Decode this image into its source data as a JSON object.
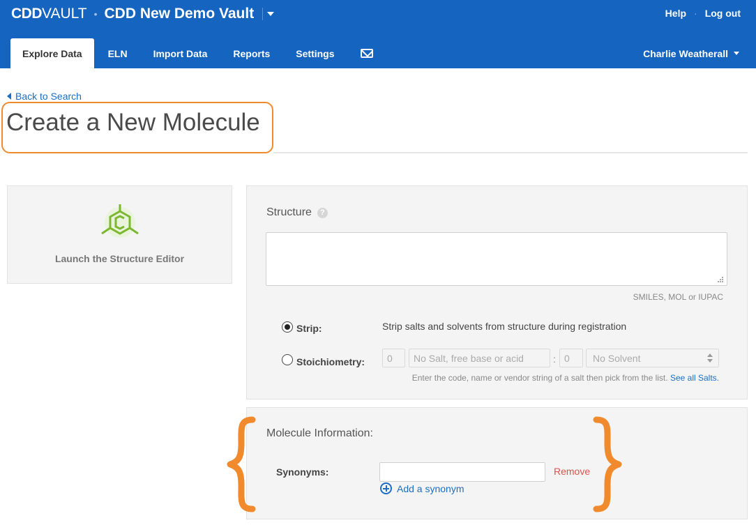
{
  "header": {
    "brand": {
      "left": "CDD",
      "right": "VAULT",
      "separator": "•"
    },
    "vault_name": "CDD New Demo Vault",
    "links": {
      "help": "Help",
      "separator": "·",
      "logout": "Log out"
    },
    "nav": [
      {
        "label": "Explore Data",
        "active": true
      },
      {
        "label": "ELN"
      },
      {
        "label": "Import Data"
      },
      {
        "label": "Reports"
      },
      {
        "label": "Settings"
      }
    ],
    "user_name": "Charlie Weatherall",
    "mail_icon": "envelope-icon"
  },
  "page": {
    "back_link": "Back to Search",
    "title": "Create a New Molecule"
  },
  "launch_panel": {
    "icon": "structure-editor-icon",
    "label": "Launch the Structure Editor"
  },
  "structure": {
    "label": "Structure",
    "help": "?",
    "input_value": "",
    "hint": "SMILES, MOL or IUPAC",
    "strip": {
      "label": "Strip:",
      "selected": true,
      "description": "Strip salts and solvents from structure during registration"
    },
    "stoichiometry": {
      "label": "Stoichiometry:",
      "selected": false,
      "salt_count": "0",
      "salt_value": "No Salt, free base or acid",
      "colon": ":",
      "solvent_count": "0",
      "solvent_value": "No Solvent",
      "hint": "Enter the code, name or vendor string of a salt then pick from the list.",
      "see_all_link": "See all Salts."
    }
  },
  "molecule_info": {
    "label": "Molecule Information:",
    "synonyms_label": "Synonyms:",
    "synonym_value": "",
    "remove_link": "Remove",
    "add_link": "Add a synonym"
  },
  "colors": {
    "header_blue": "#1565c0",
    "link_blue": "#1a6fc4",
    "annotation_orange": "#f08a2c",
    "remove_red": "#d9534f",
    "logo_green": "#7cb82f"
  }
}
